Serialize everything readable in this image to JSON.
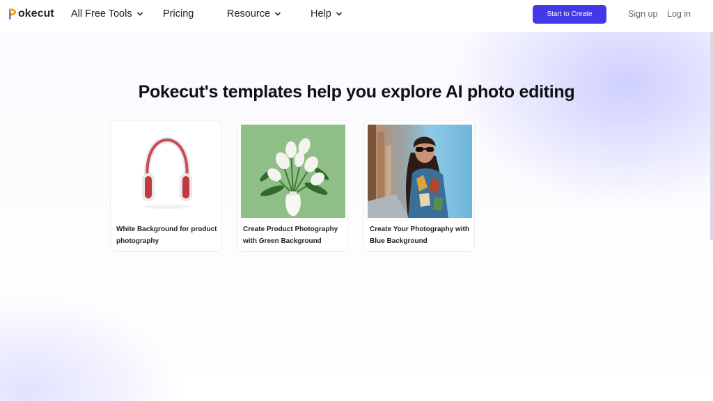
{
  "logo": {
    "text": "okecut"
  },
  "nav": {
    "items": [
      {
        "label": "All Free Tools",
        "dropdown": true
      },
      {
        "label": "Pricing",
        "dropdown": false
      },
      {
        "label": "Resource",
        "dropdown": true
      },
      {
        "label": "Help",
        "dropdown": true
      }
    ],
    "cta_label": "Start to Create",
    "sign_up": "Sign up",
    "log_in": "Log in"
  },
  "colors": {
    "accent": "#4338e6",
    "green_bg": "#8fbf86",
    "blue_bg": "#8ec8e6"
  },
  "main": {
    "title": "Pokecut's templates help you explore AI photo editing",
    "cards": [
      {
        "label": "White Background for product photography",
        "image": "headphones-image"
      },
      {
        "label": "Create Product Photography with Green Background",
        "image": "calla-lily-vase-image"
      },
      {
        "label": "Create Your Photography with Blue Background",
        "image": "woman-portrait-image"
      }
    ]
  }
}
